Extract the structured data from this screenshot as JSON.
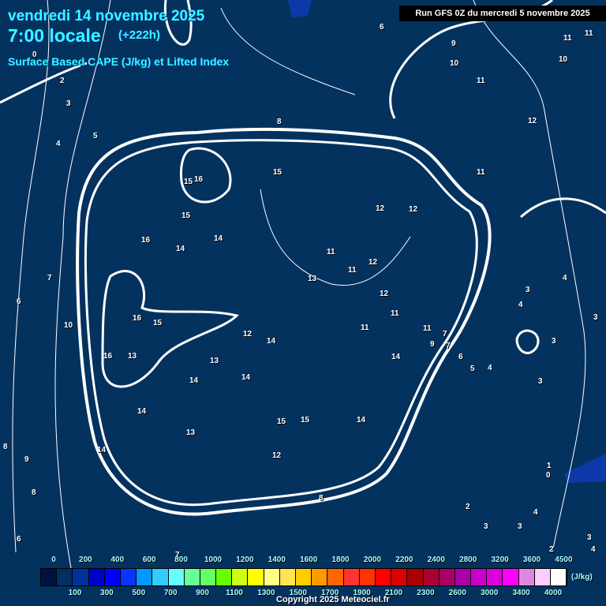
{
  "header": {
    "date": "vendredi 14 novembre 2025",
    "time": "7:00 locale",
    "lead": "(+222h)",
    "parameter": "Surface Based CAPE (J/kg) et Lifted Index",
    "run": "Run GFS 0Z du mercredi 5 novembre 2025"
  },
  "contour_labels": [
    "0",
    "2",
    "3",
    "4",
    "5",
    "7",
    "6",
    "10",
    "8",
    "9",
    "8",
    "6",
    "6",
    "15",
    "16",
    "15",
    "15",
    "14",
    "14",
    "16",
    "15",
    "16",
    "16",
    "13",
    "13",
    "14",
    "14",
    "14",
    "13",
    "12",
    "14",
    "15",
    "14",
    "12",
    "14",
    "15",
    "11",
    "12",
    "11",
    "13",
    "12",
    "12",
    "11",
    "11",
    "11",
    "14",
    "12",
    "11",
    "8",
    "9",
    "10",
    "11",
    "12",
    "10",
    "11",
    "11",
    "4",
    "4",
    "3",
    "3",
    "5",
    "4",
    "3",
    "3",
    "2",
    "3",
    "3",
    "4",
    "1",
    "0",
    "2",
    "7",
    "7",
    "6",
    "9",
    "8",
    "2",
    "3",
    "4",
    "6",
    "7"
  ],
  "legend": {
    "colors": [
      "#00123f",
      "#033060",
      "#00339a",
      "#0000cc",
      "#0000ff",
      "#0b33ff",
      "#0099ff",
      "#33ccff",
      "#66ffff",
      "#66ff99",
      "#66ff66",
      "#66ff00",
      "#ccff11",
      "#ffff00",
      "#ffff88",
      "#ffe650",
      "#ffcc00",
      "#ff9900",
      "#ff6600",
      "#ff3333",
      "#ff3300",
      "#ff0000",
      "#dd0000",
      "#aa0000",
      "#aa0033",
      "#aa0066",
      "#aa00aa",
      "#cc00cc",
      "#dd00dd",
      "#ff00ff",
      "#dd88dd",
      "#ffccff",
      "#ffffff"
    ],
    "top_ticks": [
      "0",
      "200",
      "400",
      "600",
      "800",
      "1000",
      "1200",
      "1400",
      "1600",
      "1800",
      "2000",
      "2200",
      "2400",
      "2800",
      "3200",
      "3600",
      "4500"
    ],
    "bottom_ticks": [
      "100",
      "300",
      "500",
      "700",
      "900",
      "1100",
      "1300",
      "1500",
      "1700",
      "1900",
      "2100",
      "2300",
      "2600",
      "3000",
      "3400",
      "4000"
    ],
    "unit": "(J/kg)"
  },
  "copyright": "Copyright 2025 Meteociel.fr"
}
